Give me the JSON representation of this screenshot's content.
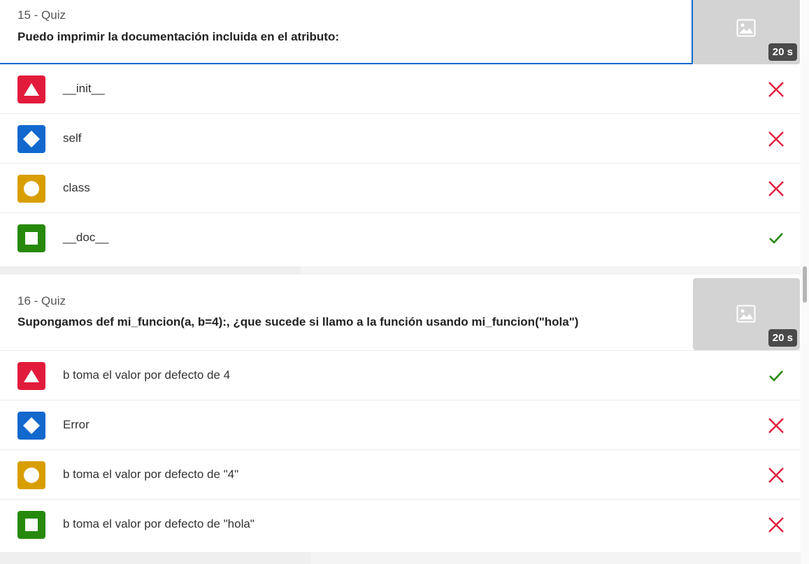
{
  "quizzes": [
    {
      "number_label": "15 - Quiz",
      "question": "Puedo imprimir la documentación incluida en el atributo:",
      "time": "20 s",
      "answers": [
        {
          "shape": "triangle",
          "color": "#e21b3c",
          "text": "__init__",
          "correct": false
        },
        {
          "shape": "diamond",
          "color": "#1368ce",
          "text": "self",
          "correct": false
        },
        {
          "shape": "circle",
          "color": "#d89e00",
          "text": "class",
          "correct": false
        },
        {
          "shape": "square",
          "color": "#26890c",
          "text": "__doc__",
          "correct": true
        }
      ]
    },
    {
      "number_label": "16 - Quiz",
      "question": "Supongamos def mi_funcion(a, b=4):, ¿que sucede si llamo a la función usando mi_funcion(\"hola\")",
      "time": "20 s",
      "answers": [
        {
          "shape": "triangle",
          "color": "#e21b3c",
          "text": "b toma el valor por defecto de 4",
          "correct": true
        },
        {
          "shape": "diamond",
          "color": "#1368ce",
          "text": "Error",
          "correct": false
        },
        {
          "shape": "circle",
          "color": "#d89e00",
          "text": "b toma el valor por defecto de \"4\"",
          "correct": false
        },
        {
          "shape": "square",
          "color": "#26890c",
          "text": "b toma el valor por defecto de \"hola\"",
          "correct": false
        }
      ]
    }
  ],
  "icons": {
    "correct": "check-icon",
    "incorrect": "x-icon",
    "image_placeholder": "image-icon"
  },
  "colors": {
    "correct": "#26890c",
    "incorrect": "#e21b3c",
    "selected_border": "#1368ce"
  }
}
